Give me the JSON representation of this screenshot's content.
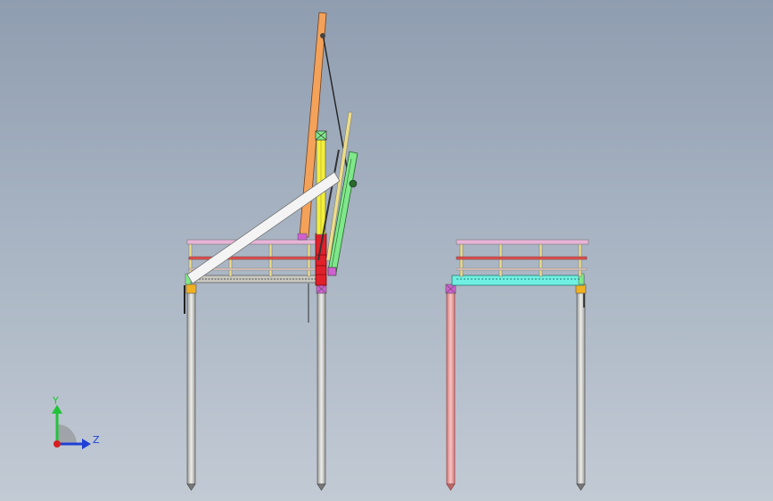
{
  "view": {
    "name": "cad-graphics-viewport",
    "background_top": "#8f9db0",
    "background_bottom": "#c2cad4"
  },
  "triad": {
    "y_label": "Y",
    "z_label": "Z",
    "y_color": "#22c33a",
    "z_color": "#1f3fd6",
    "origin_color": "#d62020"
  },
  "parts": {
    "orange_boom_color": "#f4a25a",
    "yellow_mast_color": "#f2ee3c",
    "red_mast_base_color": "#e0202a",
    "green_panel_color": "#7fe88a",
    "white_brace_color": "#f4f4f4",
    "pink_rail_color": "#e8b4d8",
    "cyan_deck_color": "#6ff0e2",
    "yellow_post_color": "#eedd88",
    "gray_pile_color": "#d8d8d4",
    "salmon_pile_color": "#f2a0a0",
    "magenta_joint_color": "#d060d0",
    "orange_cap_color": "#f0b020"
  }
}
